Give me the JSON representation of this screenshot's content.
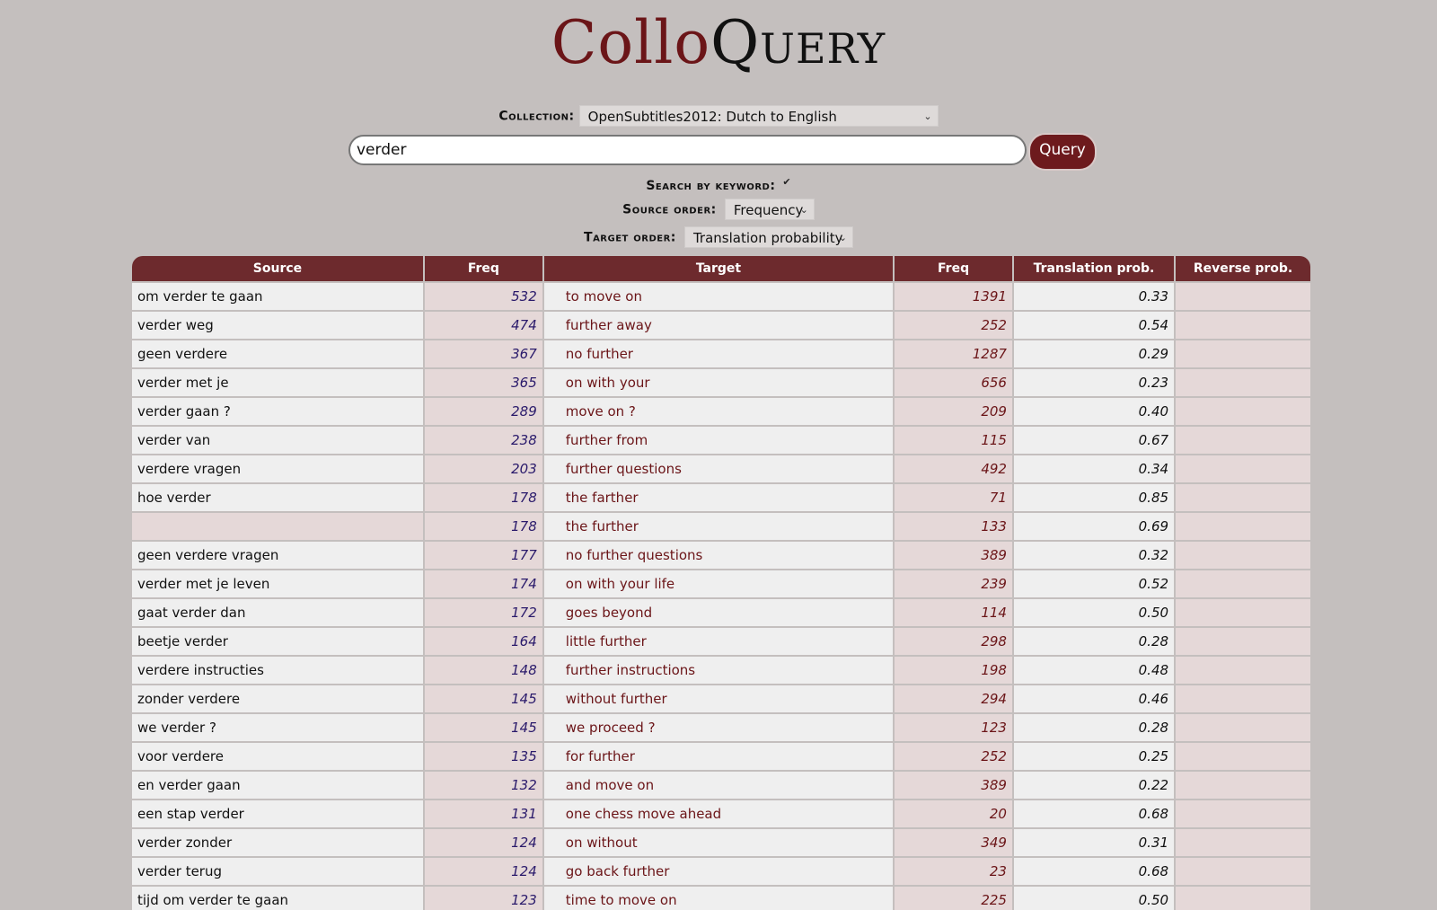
{
  "logo": {
    "part1": "Collo",
    "part2": "Query"
  },
  "collection": {
    "label": "Collection:",
    "value": "OpenSubtitles2012: Dutch to English"
  },
  "search": {
    "value": "verder",
    "button": "Query"
  },
  "keyword": {
    "label": "Search by keyword:",
    "checked": true
  },
  "source_order": {
    "label": "Source order:",
    "value": "Frequency"
  },
  "target_order": {
    "label": "Target order:",
    "value": "Translation probability"
  },
  "table": {
    "headers": [
      "Source",
      "Freq",
      "Target",
      "Freq",
      "Translation prob.",
      "Reverse prob."
    ],
    "rows": [
      {
        "source": "om verder te gaan",
        "source_freq": "532",
        "target": "to move on",
        "target_freq": "1391",
        "prob": "0.33"
      },
      {
        "source": "verder weg",
        "source_freq": "474",
        "target": "further away",
        "target_freq": "252",
        "prob": "0.54"
      },
      {
        "source": "geen verdere",
        "source_freq": "367",
        "target": "no further",
        "target_freq": "1287",
        "prob": "0.29"
      },
      {
        "source": "verder met je",
        "source_freq": "365",
        "target": "on with your",
        "target_freq": "656",
        "prob": "0.23"
      },
      {
        "source": "verder gaan ?",
        "source_freq": "289",
        "target": "move on ?",
        "target_freq": "209",
        "prob": "0.40"
      },
      {
        "source": "verder van",
        "source_freq": "238",
        "target": "further from",
        "target_freq": "115",
        "prob": "0.67"
      },
      {
        "source": "verdere vragen",
        "source_freq": "203",
        "target": "further questions",
        "target_freq": "492",
        "prob": "0.34"
      },
      {
        "source": "hoe verder",
        "source_freq": "178",
        "target": "the farther",
        "target_freq": "71",
        "prob": "0.85"
      },
      {
        "source": "",
        "source_freq": "178",
        "target": "the further",
        "target_freq": "133",
        "prob": "0.69"
      },
      {
        "source": "geen verdere vragen",
        "source_freq": "177",
        "target": "no further questions",
        "target_freq": "389",
        "prob": "0.32"
      },
      {
        "source": "verder met je leven",
        "source_freq": "174",
        "target": "on with your life",
        "target_freq": "239",
        "prob": "0.52"
      },
      {
        "source": "gaat verder dan",
        "source_freq": "172",
        "target": "goes beyond",
        "target_freq": "114",
        "prob": "0.50"
      },
      {
        "source": "beetje verder",
        "source_freq": "164",
        "target": "little further",
        "target_freq": "298",
        "prob": "0.28"
      },
      {
        "source": "verdere instructies",
        "source_freq": "148",
        "target": "further instructions",
        "target_freq": "198",
        "prob": "0.48"
      },
      {
        "source": "zonder verdere",
        "source_freq": "145",
        "target": "without further",
        "target_freq": "294",
        "prob": "0.46"
      },
      {
        "source": "we verder ?",
        "source_freq": "145",
        "target": "we proceed ?",
        "target_freq": "123",
        "prob": "0.28"
      },
      {
        "source": "voor verdere",
        "source_freq": "135",
        "target": "for further",
        "target_freq": "252",
        "prob": "0.25"
      },
      {
        "source": "en verder gaan",
        "source_freq": "132",
        "target": "and move on",
        "target_freq": "389",
        "prob": "0.22"
      },
      {
        "source": "een stap verder",
        "source_freq": "131",
        "target": "one chess move ahead",
        "target_freq": "20",
        "prob": "0.68"
      },
      {
        "source": "verder zonder",
        "source_freq": "124",
        "target": "on without",
        "target_freq": "349",
        "prob": "0.31"
      },
      {
        "source": "verder terug",
        "source_freq": "124",
        "target": "go back further",
        "target_freq": "23",
        "prob": "0.68"
      },
      {
        "source": "tijd om verder te gaan",
        "source_freq": "123",
        "target": "time to move on",
        "target_freq": "225",
        "prob": "0.50"
      },
      {
        "source": "",
        "source_freq": "",
        "target": "",
        "target_freq": "",
        "prob": ""
      }
    ]
  }
}
